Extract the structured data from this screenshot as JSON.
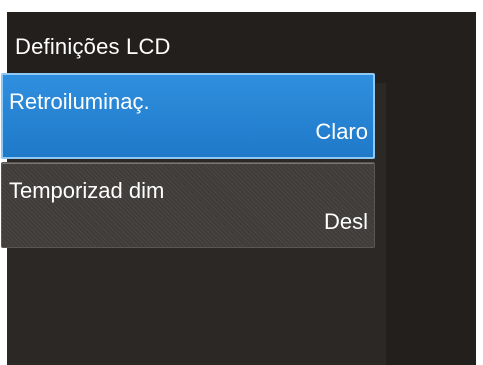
{
  "header": {
    "title": "Definições LCD"
  },
  "menu": {
    "items": [
      {
        "label": "Retroiluminaç.",
        "value": "Claro",
        "selected": true
      },
      {
        "label": "Temporizad dim",
        "value": "Desl",
        "selected": false
      }
    ]
  },
  "colors": {
    "screen_background": "#2a2624",
    "title_bar": "#221f1d",
    "selected_item": "#2a86d8",
    "selected_border": "#8fc8f5",
    "item_background": "#3f3c3a",
    "text": "#ffffff"
  }
}
